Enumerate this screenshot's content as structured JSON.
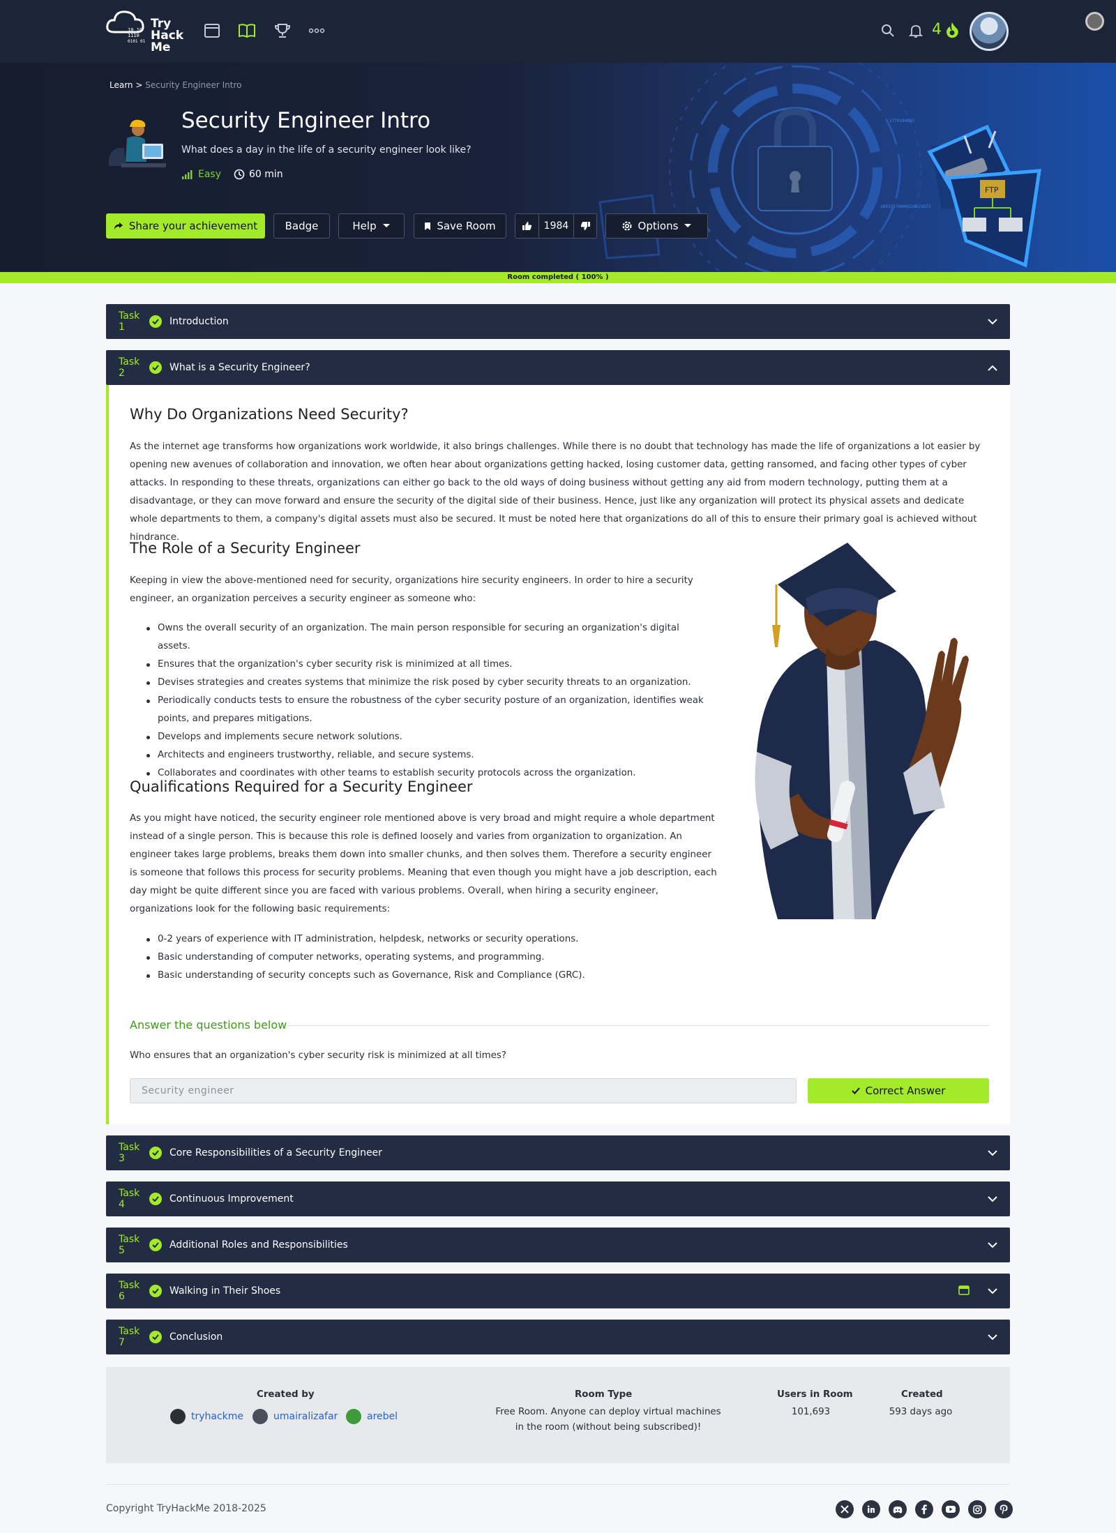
{
  "nav": {
    "logo_text": [
      "Try",
      "Hack",
      "Me"
    ],
    "streak_count": "4",
    "icons": [
      "window-icon",
      "book-icon",
      "trophy-icon",
      "more-icon"
    ]
  },
  "breadcrumb": {
    "root": "Learn",
    "sep": ">",
    "current": "Security Engineer Intro"
  },
  "room": {
    "title": "Security Engineer Intro",
    "description": "What does a day in the life of a security engineer look like?",
    "difficulty": "Easy",
    "duration": "60 min"
  },
  "actions": {
    "share": "Share your achievement",
    "badge": "Badge",
    "help": "Help",
    "save": "Save Room",
    "votes": "1984",
    "options": "Options"
  },
  "progress": {
    "label": "Room completed ( 100% )",
    "value": 1.0
  },
  "tasks": [
    {
      "num": "Task 1",
      "name": "Introduction"
    },
    {
      "num": "Task 2",
      "name": "What is a Security Engineer?"
    },
    {
      "num": "Task 3",
      "name": "Core Responsibilities of a Security Engineer"
    },
    {
      "num": "Task 4",
      "name": "Continuous Improvement"
    },
    {
      "num": "Task 5",
      "name": "Additional Roles and Responsibilities"
    },
    {
      "num": "Task 6",
      "name": "Walking in Their Shoes"
    },
    {
      "num": "Task 7",
      "name": "Conclusion"
    }
  ],
  "content": {
    "h1": "Why Do Organizations Need Security?",
    "p1": "As the internet age transforms how organizations work worldwide, it also brings challenges. While there is no doubt that technology has made the life of organizations a lot easier by opening new avenues of collaboration and innovation, we often hear about organizations getting hacked, losing customer data, getting ransomed, and facing other types of cyber attacks. In responding to these threats, organizations can either go back to the old ways of doing business without getting any aid from modern technology, putting them at a disadvantage, or they can move forward and ensure the security of the digital side of their business. Hence, just like any organization will protect its physical assets and dedicate whole departments to them, a company's digital assets must also be secured. It must be noted here that organizations do all of this to ensure their primary goal is achieved without hindrance.",
    "h2": "The Role of a Security Engineer",
    "p2": "Keeping in view the above-mentioned need for security, organizations hire security engineers. In order to hire a security engineer, an organization perceives a security engineer as someone who:",
    "list1": [
      "Owns the overall security of an organization. The main person responsible for securing an organization's digital assets.",
      "Ensures that the organization's cyber security risk is minimized at all times.",
      "Devises strategies and creates systems that minimize the risk posed by cyber security threats to an organization.",
      "Periodically conducts tests to ensure the robustness of the cyber security posture of an organization, identifies weak points, and prepares mitigations.",
      "Develops and implements secure network solutions.",
      "Architects and engineers trustworthy, reliable, and secure systems.",
      "Collaborates and coordinates with other teams to establish security protocols across the organization."
    ],
    "h3": "Qualifications Required for a Security Engineer",
    "p3": "As you might have noticed, the security engineer role mentioned above is very broad and might require a whole department instead of a single person. This is because this role is defined loosely and varies from organization to organization. An engineer takes large problems, breaks them down into smaller chunks, and then solves them. Therefore a security engineer is someone that follows this process for security problems. Meaning that even though you might have a job description, each day might be quite different since you are faced with various problems. Overall, when hiring a security engineer, organizations look for the following basic requirements:",
    "list2": [
      "0-2 years of experience with IT administration, helpdesk, networks or security operations.",
      "Basic understanding of computer networks, operating systems, and programming.",
      "Basic understanding of security concepts such as Governance, Risk and Compliance (GRC)."
    ]
  },
  "questions": {
    "heading": "Answer the questions below",
    "q1": "Who ensures that an organization's cyber security risk is minimized at all times?",
    "a1": "Security engineer",
    "correct_label": "Correct Answer"
  },
  "info": {
    "created_by_label": "Created by",
    "creators": [
      "tryhackme",
      "umairalizafar",
      "arebel"
    ],
    "room_type_label": "Room Type",
    "room_type_line1": "Free Room. Anyone can deploy virtual machines",
    "room_type_line2": "in the room (without being subscribed)!",
    "users_label": "Users in Room",
    "users": "101,693",
    "created_label": "Created",
    "created": "593 days ago"
  },
  "footer": {
    "copyright": "Copyright TryHackMe 2018-2025",
    "social": [
      "x-icon",
      "linkedin-icon",
      "discord-icon",
      "facebook-icon",
      "youtube-icon",
      "instagram-icon",
      "pinterest-icon"
    ]
  },
  "colors": {
    "accent": "#a3ea2a",
    "nav": "#1c2538",
    "task_bar": "#222c43"
  }
}
